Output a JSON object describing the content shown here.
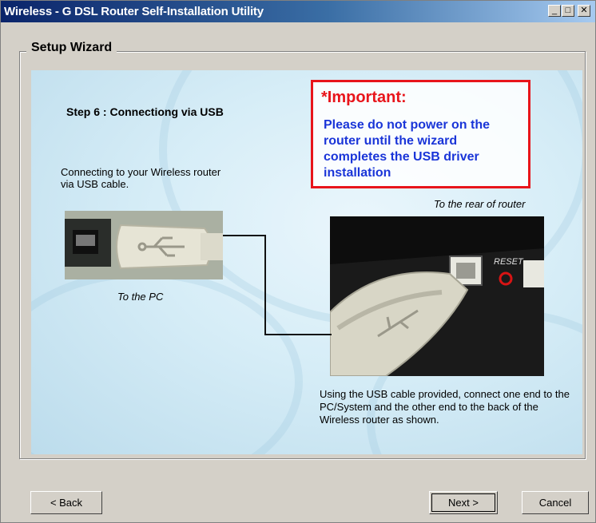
{
  "window": {
    "title": "Wireless - G DSL Router Self-Installation Utility",
    "controls": {
      "minimize": "_",
      "maximize": "□",
      "close": "✕"
    }
  },
  "group": {
    "label": "Setup Wizard"
  },
  "panel": {
    "step_title": "Step 6 : Connectiong via USB",
    "important_title": "*Important:",
    "important_body": "Please do not power on the router until the wizard completes the USB driver installation",
    "connect_text": "Connecting to your Wireless router via USB cable.",
    "caption_pc": "To the PC",
    "caption_router": "To the rear of router",
    "usage_text": "Using the USB cable provided, connect one end to the PC/System and the other end to the back of the Wireless router as shown.",
    "router_label": "RESET"
  },
  "buttons": {
    "back": "< Back",
    "next": "Next >",
    "cancel": "Cancel"
  },
  "colors": {
    "title_gradient_start": "#0a246a",
    "important_border": "#e8151b",
    "important_text": "#1a35d8"
  }
}
